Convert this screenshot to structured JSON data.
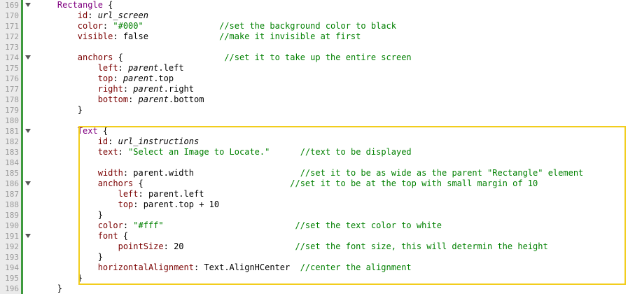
{
  "editor": {
    "lines": [
      {
        "num": "169",
        "fold": true,
        "tokens": [
          {
            "t": "    "
          },
          {
            "t": "Rectangle",
            "c": "typ"
          },
          {
            "t": " {"
          }
        ]
      },
      {
        "num": "170",
        "fold": false,
        "tokens": [
          {
            "t": "        "
          },
          {
            "t": "id",
            "c": "prop"
          },
          {
            "t": ": "
          },
          {
            "t": "url_screen",
            "c": "ital"
          }
        ]
      },
      {
        "num": "171",
        "fold": false,
        "tokens": [
          {
            "t": "        "
          },
          {
            "t": "color",
            "c": "prop"
          },
          {
            "t": ": "
          },
          {
            "t": "\"#000\"",
            "c": "str"
          },
          {
            "t": "               "
          },
          {
            "t": "//set the background color to black",
            "c": "cmt"
          }
        ]
      },
      {
        "num": "172",
        "fold": false,
        "tokens": [
          {
            "t": "        "
          },
          {
            "t": "visible",
            "c": "prop"
          },
          {
            "t": ": false              "
          },
          {
            "t": "//make it invisible at first",
            "c": "cmt"
          }
        ]
      },
      {
        "num": "173",
        "fold": false,
        "tokens": []
      },
      {
        "num": "174",
        "fold": true,
        "tokens": [
          {
            "t": "        "
          },
          {
            "t": "anchors",
            "c": "prop"
          },
          {
            "t": " {                    "
          },
          {
            "t": "//set it to take up the entire screen",
            "c": "cmt"
          }
        ]
      },
      {
        "num": "175",
        "fold": false,
        "tokens": [
          {
            "t": "            "
          },
          {
            "t": "left",
            "c": "prop"
          },
          {
            "t": ": "
          },
          {
            "t": "parent",
            "c": "ital"
          },
          {
            "t": ".left"
          }
        ]
      },
      {
        "num": "176",
        "fold": false,
        "tokens": [
          {
            "t": "            "
          },
          {
            "t": "top",
            "c": "prop"
          },
          {
            "t": ": "
          },
          {
            "t": "parent",
            "c": "ital"
          },
          {
            "t": ".top"
          }
        ]
      },
      {
        "num": "177",
        "fold": false,
        "tokens": [
          {
            "t": "            "
          },
          {
            "t": "right",
            "c": "prop"
          },
          {
            "t": ": "
          },
          {
            "t": "parent",
            "c": "ital"
          },
          {
            "t": ".right"
          }
        ]
      },
      {
        "num": "178",
        "fold": false,
        "tokens": [
          {
            "t": "            "
          },
          {
            "t": "bottom",
            "c": "prop"
          },
          {
            "t": ": "
          },
          {
            "t": "parent",
            "c": "ital"
          },
          {
            "t": ".bottom"
          }
        ]
      },
      {
        "num": "179",
        "fold": false,
        "tokens": [
          {
            "t": "        }"
          }
        ]
      },
      {
        "num": "180",
        "fold": false,
        "tokens": []
      },
      {
        "num": "181",
        "fold": true,
        "tokens": [
          {
            "t": "        "
          },
          {
            "t": "Text",
            "c": "typ"
          },
          {
            "t": " {"
          }
        ]
      },
      {
        "num": "182",
        "fold": false,
        "tokens": [
          {
            "t": "            "
          },
          {
            "t": "id",
            "c": "prop"
          },
          {
            "t": ": "
          },
          {
            "t": "url_instructions",
            "c": "ital"
          }
        ]
      },
      {
        "num": "183",
        "fold": false,
        "tokens": [
          {
            "t": "            "
          },
          {
            "t": "text",
            "c": "prop"
          },
          {
            "t": ": "
          },
          {
            "t": "\"Select an Image to Locate.\"",
            "c": "str"
          },
          {
            "t": "      "
          },
          {
            "t": "//text to be displayed",
            "c": "cmt"
          }
        ]
      },
      {
        "num": "184",
        "fold": false,
        "tokens": []
      },
      {
        "num": "185",
        "fold": false,
        "tokens": [
          {
            "t": "            "
          },
          {
            "t": "width",
            "c": "prop"
          },
          {
            "t": ": parent.width                     "
          },
          {
            "t": "//set it to be as wide as the parent \"Rectangle\" element",
            "c": "cmt"
          }
        ]
      },
      {
        "num": "186",
        "fold": true,
        "tokens": [
          {
            "t": "            "
          },
          {
            "t": "anchors",
            "c": "prop"
          },
          {
            "t": " {                             "
          },
          {
            "t": "//set it to be at the top with small margin of 10",
            "c": "cmt"
          }
        ]
      },
      {
        "num": "187",
        "fold": false,
        "tokens": [
          {
            "t": "                "
          },
          {
            "t": "left",
            "c": "prop"
          },
          {
            "t": ": parent.left"
          }
        ]
      },
      {
        "num": "188",
        "fold": false,
        "tokens": [
          {
            "t": "                "
          },
          {
            "t": "top",
            "c": "prop"
          },
          {
            "t": ": parent.top + 10"
          }
        ]
      },
      {
        "num": "189",
        "fold": false,
        "tokens": [
          {
            "t": "            }"
          }
        ]
      },
      {
        "num": "190",
        "fold": false,
        "tokens": [
          {
            "t": "            "
          },
          {
            "t": "color",
            "c": "prop"
          },
          {
            "t": ": "
          },
          {
            "t": "\"#fff\"",
            "c": "str"
          },
          {
            "t": "                          "
          },
          {
            "t": "//set the text color to white",
            "c": "cmt"
          }
        ]
      },
      {
        "num": "191",
        "fold": true,
        "tokens": [
          {
            "t": "            "
          },
          {
            "t": "font",
            "c": "prop"
          },
          {
            "t": " {"
          }
        ]
      },
      {
        "num": "192",
        "fold": false,
        "tokens": [
          {
            "t": "                "
          },
          {
            "t": "pointSize",
            "c": "prop"
          },
          {
            "t": ": 20                      "
          },
          {
            "t": "//set the font size, this will determin the height",
            "c": "cmt"
          }
        ]
      },
      {
        "num": "193",
        "fold": false,
        "tokens": [
          {
            "t": "            }"
          }
        ]
      },
      {
        "num": "194",
        "fold": false,
        "tokens": [
          {
            "t": "            "
          },
          {
            "t": "horizontalAlignment",
            "c": "prop"
          },
          {
            "t": ": Text.AlignHCenter  "
          },
          {
            "t": "//center the alignment",
            "c": "cmt"
          }
        ]
      },
      {
        "num": "195",
        "fold": false,
        "tokens": [
          {
            "t": "        }"
          }
        ]
      },
      {
        "num": "196",
        "fold": false,
        "tokens": [
          {
            "t": "    }"
          }
        ]
      }
    ],
    "colors": {
      "gutter_bg": "#ebebeb",
      "fold_strip": "#3e9a3e",
      "highlight_border": "#f2cd1d",
      "keyword": "#800080",
      "property": "#7a0000",
      "string": "#008000",
      "comment": "#008000"
    }
  }
}
